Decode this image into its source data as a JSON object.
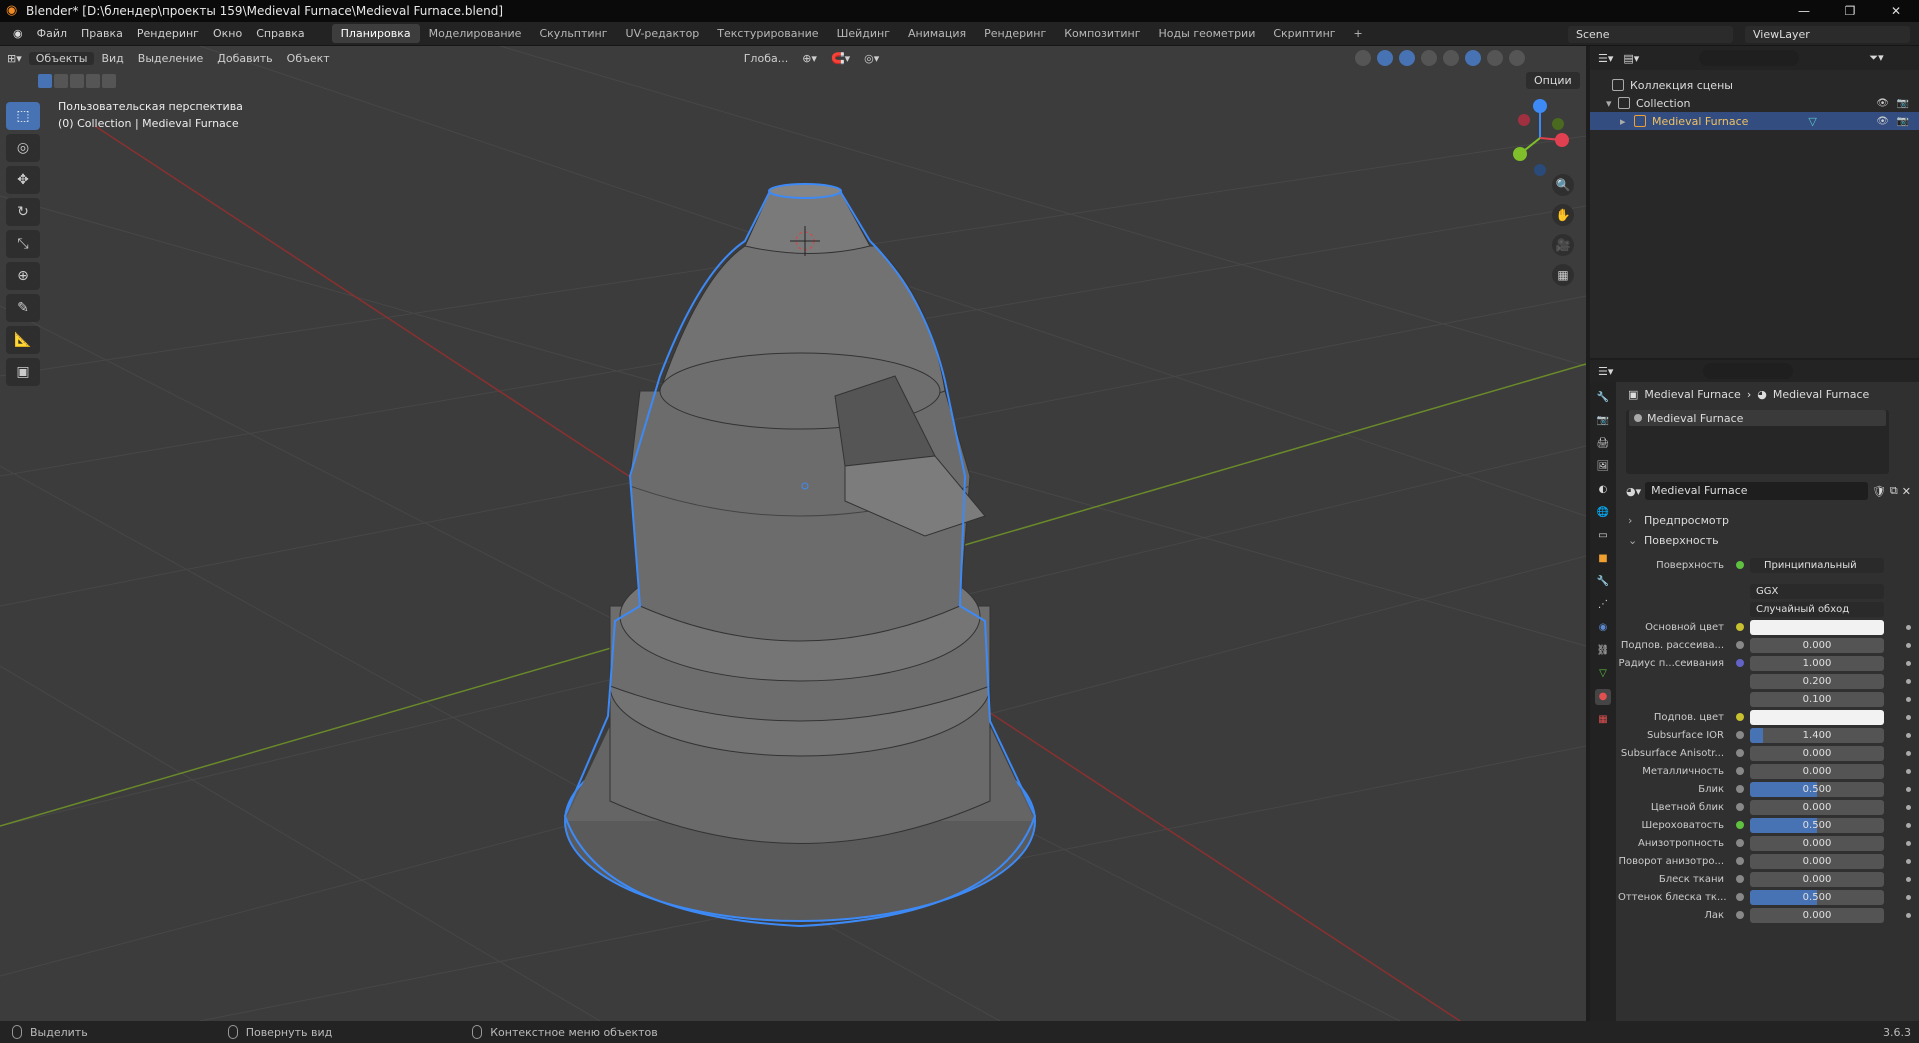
{
  "window": {
    "title": "Blender* [D:\\блендер\\проекты 159\\Medieval Furnace\\Medieval Furnace.blend]",
    "minimize": "—",
    "maximize": "❐",
    "close": "✕"
  },
  "menu": [
    "Файл",
    "Правка",
    "Рендеринг",
    "Окно",
    "Справка"
  ],
  "workspaces": [
    {
      "label": "Планировка",
      "active": true
    },
    {
      "label": "Моделирование",
      "active": false
    },
    {
      "label": "Скульптинг",
      "active": false
    },
    {
      "label": "UV-редактор",
      "active": false
    },
    {
      "label": "Текстурирование",
      "active": false
    },
    {
      "label": "Шейдинг",
      "active": false
    },
    {
      "label": "Анимация",
      "active": false
    },
    {
      "label": "Рендеринг",
      "active": false
    },
    {
      "label": "Композитинг",
      "active": false
    },
    {
      "label": "Ноды геометрии",
      "active": false
    },
    {
      "label": "Скриптинг",
      "active": false
    },
    {
      "label": "+",
      "active": false
    }
  ],
  "scene": {
    "name": "Scene",
    "view_layer": "ViewLayer"
  },
  "viewport": {
    "mode": "Объекты",
    "menus": [
      "Вид",
      "Выделение",
      "Добавить",
      "Объект"
    ],
    "orientation": "Глоба...",
    "options": "Опции",
    "overlay_line1": "Пользовательская перспектива",
    "overlay_line2": "(0) Collection | Medieval Furnace"
  },
  "outliner": {
    "rows": [
      {
        "label": "Коллекция сцены",
        "level": 0,
        "selected": false
      },
      {
        "label": "Collection",
        "level": 1,
        "selected": false
      },
      {
        "label": "Medieval Furnace",
        "level": 2,
        "selected": true
      }
    ]
  },
  "properties": {
    "breadcrumb_object": "Medieval Furnace",
    "breadcrumb_material": "Medieval Furnace",
    "material_slot": "Medieval Furnace",
    "material_name": "Medieval Furnace",
    "sections": {
      "preview": "Предпросмотр",
      "surface": "Поверхность"
    },
    "surface_label": "Поверхность",
    "surface_value": "Принципиальный BSDF",
    "distribution": "GGX",
    "subsurface_method": "Случайный обход",
    "rows": [
      {
        "label": "Основной цвет",
        "value": "",
        "kind": "white",
        "dot": "yellow"
      },
      {
        "label": "Подпов. рассеива...",
        "value": "0.000",
        "kind": "num",
        "dot": "gray"
      },
      {
        "label": "Радиус п...сеивания",
        "value": "1.000",
        "kind": "num",
        "dot": "purple"
      },
      {
        "label": "",
        "value": "0.200",
        "kind": "num",
        "dot": ""
      },
      {
        "label": "",
        "value": "0.100",
        "kind": "num",
        "dot": ""
      },
      {
        "label": "Подпов. цвет",
        "value": "",
        "kind": "white",
        "dot": "yellow"
      },
      {
        "label": "Subsurface IOR",
        "value": "1.400",
        "kind": "num",
        "dot": "gray",
        "fill": 0.1
      },
      {
        "label": "Subsurface Anisotr...",
        "value": "0.000",
        "kind": "num",
        "dot": "gray"
      },
      {
        "label": "Металличность",
        "value": "0.000",
        "kind": "num",
        "dot": "gray"
      },
      {
        "label": "Блик",
        "value": "0.500",
        "kind": "num",
        "dot": "gray",
        "fill": 0.5
      },
      {
        "label": "Цветной блик",
        "value": "0.000",
        "kind": "num",
        "dot": "gray"
      },
      {
        "label": "Шероховатость",
        "value": "0.500",
        "kind": "num",
        "dot": "green",
        "fill": 0.5
      },
      {
        "label": "Анизотропность",
        "value": "0.000",
        "kind": "num",
        "dot": "gray"
      },
      {
        "label": "Поворот анизотро...",
        "value": "0.000",
        "kind": "num",
        "dot": "gray"
      },
      {
        "label": "Блеск ткани",
        "value": "0.000",
        "kind": "num",
        "dot": "gray"
      },
      {
        "label": "Оттенок блеска тк...",
        "value": "0.500",
        "kind": "num",
        "dot": "gray",
        "fill": 0.5
      },
      {
        "label": "Лак",
        "value": "0.000",
        "kind": "num",
        "dot": "gray"
      }
    ]
  },
  "status": {
    "select": "Выделить",
    "rotate": "Повернуть вид",
    "context": "Контекстное меню объектов",
    "version": "3.6.3"
  },
  "colors": {
    "accent": "#4772b3",
    "selection_outline": "#3d8af7",
    "object_active": "#f0a030"
  }
}
